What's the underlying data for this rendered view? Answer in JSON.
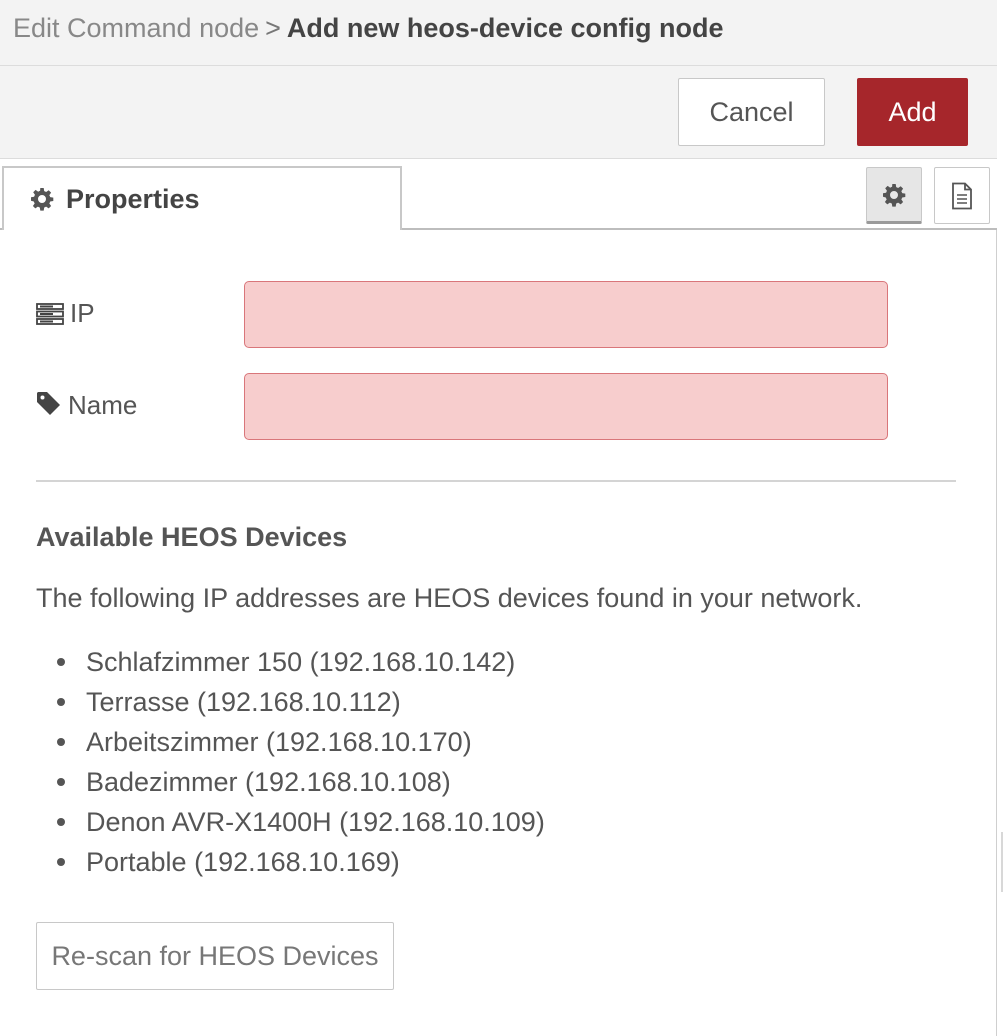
{
  "header": {
    "crumb_prev": "Edit Command node",
    "crumb_sep": ">",
    "crumb_current": "Add new heos-device config node"
  },
  "toolbar": {
    "cancel_label": "Cancel",
    "add_label": "Add"
  },
  "tabs": {
    "properties_label": "Properties",
    "settings_icon": "gear-icon",
    "docs_icon": "document-icon"
  },
  "form": {
    "ip_label": "IP",
    "ip_icon": "server-icon",
    "ip_value": "",
    "name_label": "Name",
    "name_icon": "tag-icon",
    "name_value": ""
  },
  "devices": {
    "title": "Available HEOS Devices",
    "description": "The following IP addresses are HEOS devices found in your network.",
    "items": [
      "Schlafzimmer 150 (192.168.10.142)",
      "Terrasse (192.168.10.112)",
      "Arbeitszimmer (192.168.10.170)",
      "Badezimmer (192.168.10.108)",
      "Denon AVR-X1400H (192.168.10.109)",
      "Portable (192.168.10.169)"
    ],
    "rescan_label": "Re-scan for HEOS Devices"
  },
  "colors": {
    "accent": "#a6262b",
    "invalid_input_bg": "#f7cdcd",
    "invalid_input_border": "#d9767a"
  }
}
